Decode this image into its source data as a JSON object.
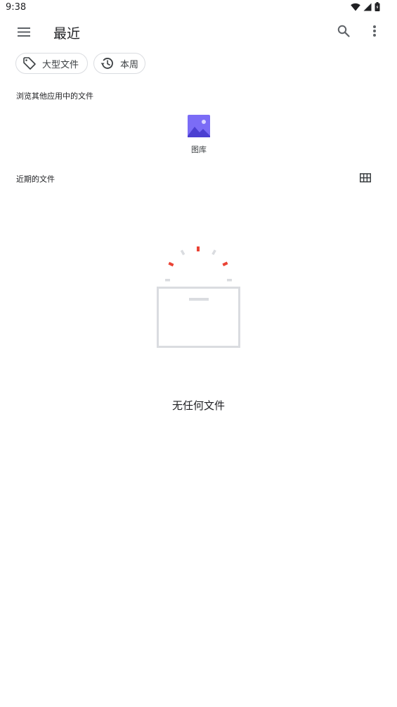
{
  "status_bar": {
    "time": "9:38",
    "icons": [
      "wifi-icon",
      "cell-signal-icon",
      "battery-icon"
    ]
  },
  "app_bar": {
    "title": "最近",
    "menu_icon": "hamburger-menu-icon",
    "search_icon": "search-icon",
    "more_icon": "more-vert-icon"
  },
  "filters": [
    {
      "label": "大型文件",
      "icon": "tag-icon"
    },
    {
      "label": "本周",
      "icon": "history-icon"
    }
  ],
  "browse_section": {
    "heading": "浏览其他应用中的文件",
    "apps": [
      {
        "label": "图库",
        "icon": "gallery-icon"
      }
    ]
  },
  "recent_section": {
    "heading": "近期的文件",
    "view_toggle_icon": "grid-view-icon"
  },
  "empty_state": {
    "message": "无任何文件"
  },
  "colors": {
    "gallery_accent": "#7b6cf6",
    "spark_red": "#ea4335",
    "illustration_gray": "#dadce0"
  }
}
